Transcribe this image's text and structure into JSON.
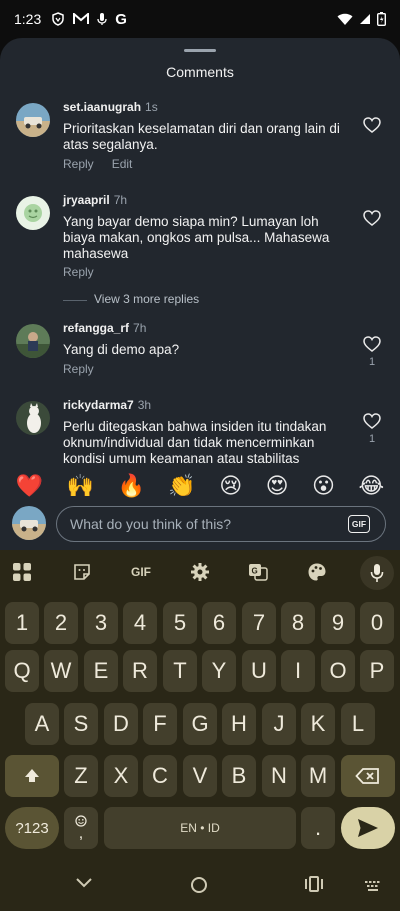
{
  "status_bar": {
    "time": "1:23",
    "notification_icons": [
      "shield-icon",
      "mail-m-icon",
      "mic-small-icon",
      "google-g-icon"
    ],
    "g_label": "G"
  },
  "sheet": {
    "title": "Comments"
  },
  "comments": [
    {
      "username": "set.iaanugrah",
      "time": "1s",
      "text": "Prioritaskan keselamatan diri dan orang lain di atas segalanya.",
      "actions": [
        "Reply",
        "Edit"
      ],
      "like_count": ""
    },
    {
      "username": "jryaapril",
      "time": "7h",
      "text": "Yang bayar demo siapa min? Lumayan loh biaya makan, ongkos am pulsa... Mahasewa mahasewa",
      "actions": [
        "Reply"
      ],
      "like_count": ""
    },
    {
      "username": "refangga_rf",
      "time": "7h",
      "text": "Yang di demo apa?",
      "actions": [
        "Reply"
      ],
      "like_count": "1"
    },
    {
      "username": "rickydarma7",
      "time": "3h",
      "text": "Perlu ditegaskan bahwa insiden itu tindakan oknum/individual dan tidak mencerminkan kondisi umum keamanan atau stabilitas",
      "actions": [],
      "like_count": "1"
    }
  ],
  "more_replies": "View 3 more replies",
  "reactions": [
    "❤️",
    "🙌",
    "🔥",
    "👏",
    "😢",
    "😍",
    "😮",
    "😂"
  ],
  "composer": {
    "placeholder": "What do you think of this?",
    "gif_label": "GIF"
  },
  "keyboard": {
    "toolbar_gif_label": "GIF",
    "number_row": [
      "1",
      "2",
      "3",
      "4",
      "5",
      "6",
      "7",
      "8",
      "9",
      "0"
    ],
    "row1": [
      "Q",
      "W",
      "E",
      "R",
      "T",
      "Y",
      "U",
      "I",
      "O",
      "P"
    ],
    "row2": [
      "A",
      "S",
      "D",
      "F",
      "G",
      "H",
      "J",
      "K",
      "L"
    ],
    "row3": [
      "Z",
      "X",
      "C",
      "V",
      "B",
      "N",
      "M"
    ],
    "symbols_label": "?123",
    "emoji_comma": "☺\n,",
    "space_label": "EN • ID",
    "period_label": ".",
    "accent_color": "#d9d2a7"
  }
}
